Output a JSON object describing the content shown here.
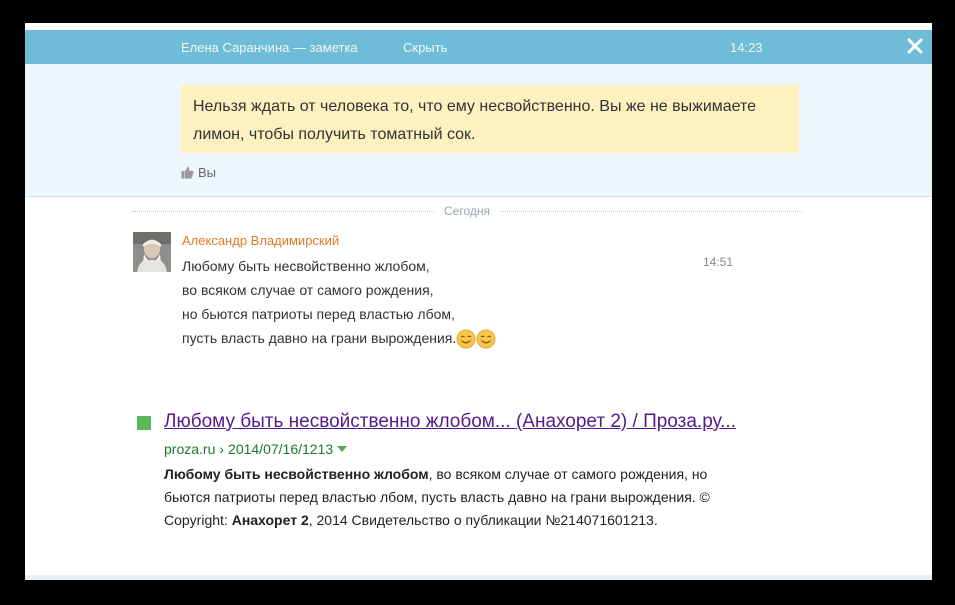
{
  "header": {
    "author": "Елена Саранчина — заметка",
    "hide_label": "Скрыть",
    "time": "14:23",
    "close_icon": "close-icon"
  },
  "note": {
    "text": "Нельзя ждать от человека то, что ему несвойственно. Вы же не выжимаете лимон, чтобы получить томатный сок."
  },
  "likes": {
    "icon": "thumb-up-icon",
    "label": "Вы"
  },
  "divider": {
    "label": "Сегодня"
  },
  "message": {
    "author": "Александр Владимирский",
    "time": "14:51",
    "lines": [
      "Любому быть несвойственно жлобом,",
      "во всяком случае от самого рождения,",
      "но бьются патриоты перед властью лбом,",
      "пусть власть давно на грани вырождения."
    ],
    "emoji_icon": "smiley-icon"
  },
  "search_result": {
    "title": "Любому быть несвойственно жлобом... (Анахорет 2) / Проза.ру...",
    "url_domain": "proza.ru",
    "url_separator": " › ",
    "url_path": "2014/07/16/1213",
    "snippet_bold1": "Любому быть несвойственно жлобом",
    "snippet_part1": ", во всяком случае от самого рождения, но бьются патриоты перед властью лбом, пусть власть давно на грани вырождения. © Copyright: ",
    "snippet_bold2": "Анахорет 2",
    "snippet_part2": ", 2014 Свидетельство о публикации №214071601213."
  },
  "colors": {
    "header_bg": "#6fbcd8",
    "note_bg": "#fdf1c0",
    "author_orange": "#e07b25",
    "link_purple": "#551a8b",
    "url_green": "#1a7a2a"
  }
}
